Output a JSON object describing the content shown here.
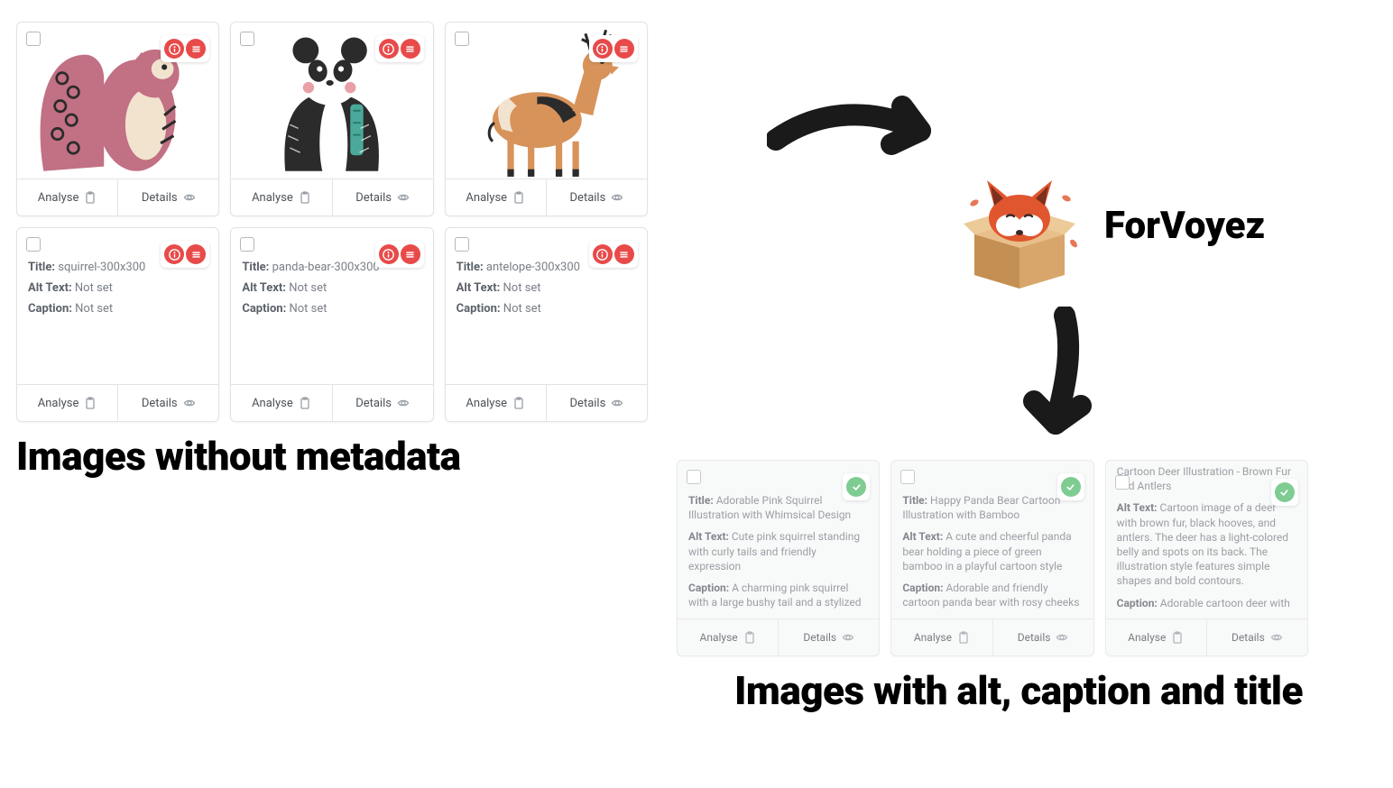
{
  "brand": {
    "name": "ForVoyez"
  },
  "headings": {
    "left": "Images without metadata",
    "right": "Images with alt, caption and title"
  },
  "labels": {
    "title": "Title:",
    "alt": "Alt Text:",
    "caption": "Caption:",
    "analyse": "Analyse",
    "details": "Details",
    "not_set": "Not set"
  },
  "before_cards_row1": [
    {
      "animal": "squirrel"
    },
    {
      "animal": "panda"
    },
    {
      "animal": "antelope"
    }
  ],
  "before_cards_row2": [
    {
      "title": "squirrel-300x300",
      "alt": "Not set",
      "caption": "Not set"
    },
    {
      "title": "panda-bear-300x300",
      "alt": "Not set",
      "caption": "Not set"
    },
    {
      "title": "antelope-300x300",
      "alt": "Not set",
      "caption": "Not set"
    }
  ],
  "after_cards": [
    {
      "title": "Adorable Pink Squirrel Illustration with Whimsical Design",
      "alt": "Cute pink squirrel standing with curly tails and friendly expression",
      "caption": "A charming pink squirrel with a large bushy tail and a stylized"
    },
    {
      "title": "Happy Panda Bear Cartoon Illustration with Bamboo",
      "alt": "A cute and cheerful panda bear holding a piece of green bamboo in a playful cartoon style",
      "caption": "Adorable and friendly cartoon panda bear with rosy cheeks"
    },
    {
      "title_prefix": "Cartoon Deer Illustration - Brown Fur and Antlers",
      "alt": "Cartoon image of a deer with brown fur, black hooves, and antlers. The deer has a light-colored belly and spots on its back. The illustration style features simple shapes and bold contours.",
      "caption": "Adorable cartoon deer with"
    }
  ]
}
